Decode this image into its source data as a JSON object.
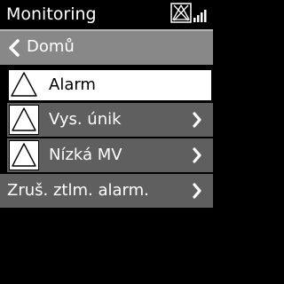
{
  "header": {
    "title": "Monitoring",
    "icons": [
      "alarm-muted-icon",
      "signal-bars-icon"
    ]
  },
  "back": {
    "label": "Domů",
    "icon": "chevron-left-icon"
  },
  "menu": {
    "items": [
      {
        "label": "Alarm",
        "icon": "warning-triangle-icon",
        "selected": true,
        "has_submenu": false
      },
      {
        "label": "Vys. únik",
        "icon": "warning-triangle-icon",
        "selected": false,
        "has_submenu": true
      },
      {
        "label": "Nízká MV",
        "icon": "warning-triangle-icon",
        "selected": false,
        "has_submenu": true
      },
      {
        "label": "Zruš. ztlm. alarm.",
        "icon": null,
        "selected": false,
        "has_submenu": true
      }
    ]
  },
  "colors": {
    "background": "#000000",
    "item_background": "#5f5f5f",
    "back_row_background": "#888888",
    "selected_background": "#ffffff",
    "text": "#ffffff"
  }
}
